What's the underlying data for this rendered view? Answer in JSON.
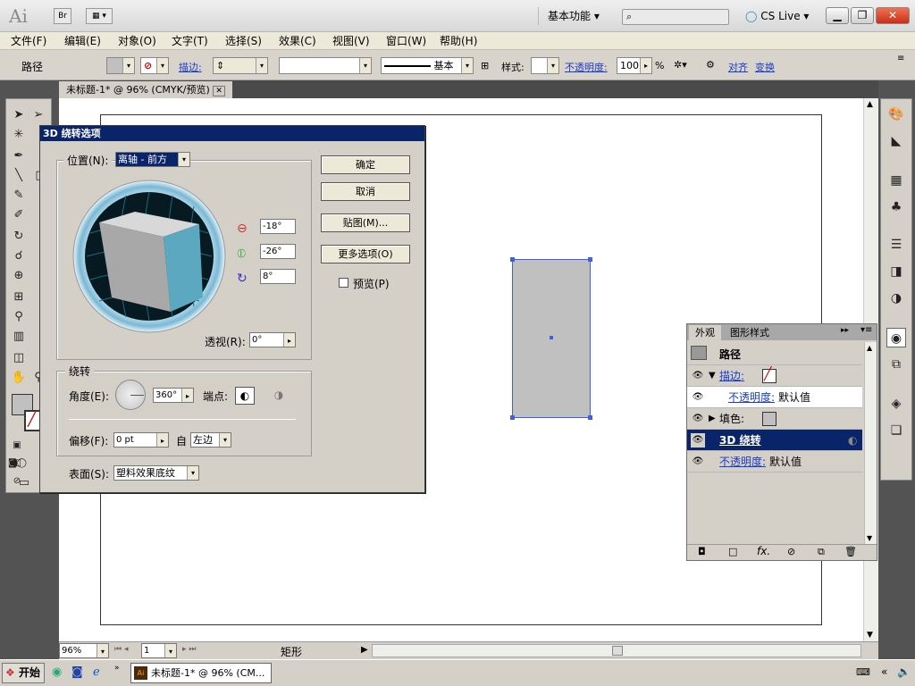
{
  "app": {
    "logo": "Ai",
    "bridge": "Br",
    "workspace": "基本功能",
    "cslive": "CS Live"
  },
  "menu": [
    "文件(F)",
    "编辑(E)",
    "对象(O)",
    "文字(T)",
    "选择(S)",
    "效果(C)",
    "视图(V)",
    "窗口(W)",
    "帮助(H)"
  ],
  "controlbar": {
    "object_type": "路径",
    "stroke_label": "描边:",
    "stroke_line_label": "基本",
    "style_label": "样式:",
    "opacity_label": "不透明度:",
    "opacity_value": "100",
    "opacity_unit": "%",
    "align_label": "对齐",
    "transform_label": "变换"
  },
  "document": {
    "tab_title": "未标题-1* @ 96% (CMYK/预览)"
  },
  "dialog": {
    "title": "3D 绕转选项",
    "position_label": "位置(N):",
    "position_value": "离轴 - 前方",
    "rot_x": "-18°",
    "rot_y": "-26°",
    "rot_z": "8°",
    "perspective_label": "透视(R):",
    "perspective_value": "0°",
    "revolve_group": "绕转",
    "angle_label": "角度(E):",
    "angle_value": "360°",
    "cap_label": "端点:",
    "offset_label": "偏移(F):",
    "offset_value": "0 pt",
    "from_label": "自",
    "from_value": "左边",
    "surface_label": "表面(S):",
    "surface_value": "塑料效果底纹",
    "ok": "确定",
    "cancel": "取消",
    "map": "贴图(M)...",
    "more": "更多选项(O)",
    "preview": "预览(P)"
  },
  "appearance": {
    "tab1": "外观",
    "tab2": "图形样式",
    "header": "路径",
    "rows": [
      {
        "label": "描边:"
      },
      {
        "label": "不透明度:",
        "value": "默认值"
      },
      {
        "label": "填色:"
      },
      {
        "label": "3D 绕转"
      },
      {
        "label": "不透明度:",
        "value": "默认值"
      }
    ]
  },
  "status": {
    "zoom": "96%",
    "page": "1",
    "tool_name": "矩形"
  },
  "taskbar": {
    "start": "开始",
    "doc": "未标题-1* @ 96% (CM..."
  },
  "colors": {
    "title_blue": "#0a246a",
    "cube_face": "#5ba8c0",
    "object_fill": "#c0c0c0",
    "selection": "#4060e0"
  }
}
